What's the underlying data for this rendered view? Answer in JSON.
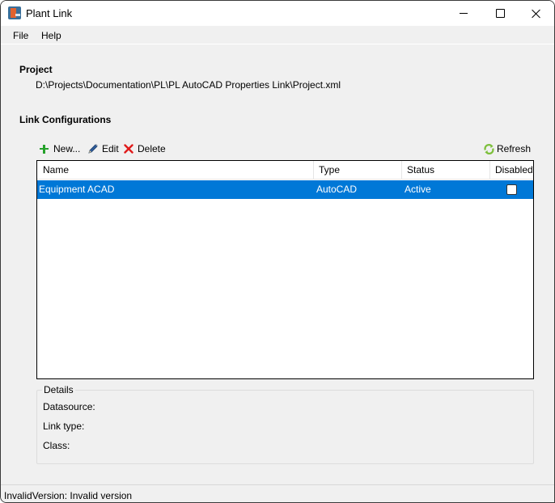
{
  "window": {
    "title": "Plant Link",
    "app_icon": "plant-link-app-icon",
    "controls": {
      "minimize": "minimize-icon",
      "maximize": "maximize-icon",
      "close": "close-icon"
    }
  },
  "menu": {
    "items": [
      {
        "label": "File"
      },
      {
        "label": "Help"
      }
    ]
  },
  "project": {
    "title": "Project",
    "path": "D:\\Projects\\Documentation\\PL\\PL AutoCAD Properties Link\\Project.xml"
  },
  "link_configurations": {
    "title": "Link Configurations",
    "toolbar": {
      "new_label": "New...",
      "new_icon": "plus-icon",
      "edit_label": "Edit",
      "edit_icon": "pencil-icon",
      "delete_label": "Delete",
      "delete_icon": "x-icon",
      "refresh_label": "Refresh",
      "refresh_icon": "refresh-icon"
    },
    "table": {
      "columns": [
        "Name",
        "Type",
        "Status",
        "Disabled"
      ],
      "rows": [
        {
          "name": "Equipment ACAD",
          "type": "AutoCAD",
          "status": "Active",
          "disabled": false,
          "selected": true
        }
      ]
    }
  },
  "details": {
    "legend": "Details",
    "fields": [
      {
        "label": "Datasource:",
        "value": ""
      },
      {
        "label": "Link type:",
        "value": ""
      },
      {
        "label": "Class:",
        "value": ""
      }
    ]
  },
  "status_bar": {
    "text": "InvalidVersion: Invalid version"
  },
  "colors": {
    "selection": "#0078d7",
    "window_bg": "#f0f0f0",
    "add_green": "#25a12a",
    "delete_red": "#e01b1b",
    "refresh_green": "#7cbf3a"
  }
}
